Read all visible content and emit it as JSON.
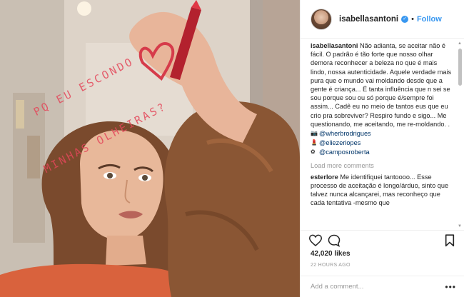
{
  "post": {
    "photo": {
      "mirror_text": [
        "PQ EU ESCONDO",
        "MINHAS OLHEIRAS?"
      ]
    },
    "header": {
      "username": "isabellasantoni",
      "follow_label": "Follow",
      "separator": "•"
    },
    "caption": {
      "username": "isabellasantoni",
      "text": "Não adianta, se aceitar não é fácil. O padrão é tão forte que nosso olhar demora reconhecer a beleza no que é mais lindo, nossa autenticidade. Aquele verdade mais pura que o mundo vai moldando desde que a gente é criança... É tanta influência que n sei se sou porque sou ou só porque é/sempre foi assim... Cadê eu no meio de tantos eus que eu crio pra sobreviver? Respiro fundo e sigo... Me questionando, me aceitando, me re-moldando. .",
      "credits": [
        {
          "icon": "camera-icon",
          "glyph": "📷",
          "handle": "@wherbrodrigues"
        },
        {
          "icon": "lipstick-icon",
          "glyph": "💄",
          "handle": "@eliezeriopes"
        },
        {
          "icon": "sparkle-icon",
          "glyph": "✿",
          "handle": "@camposroberta"
        }
      ]
    },
    "load_more": "Load more comments",
    "comment": {
      "username": "esterlore",
      "text": "Me identifiquei tantoooo... Esse processo de aceitação é longo/árduo, sinto que talvez nunca alcançarei, mas reconheço que cada tentativa -mesmo que"
    },
    "likes": "42,020 likes",
    "timestamp": "22 HOURS AGO",
    "add_comment": {
      "placeholder": "Add a comment..."
    },
    "more_label": "•••",
    "colors": {
      "link": "#003569",
      "follow": "#3897f0",
      "lipstick": "#d63b4a"
    }
  }
}
